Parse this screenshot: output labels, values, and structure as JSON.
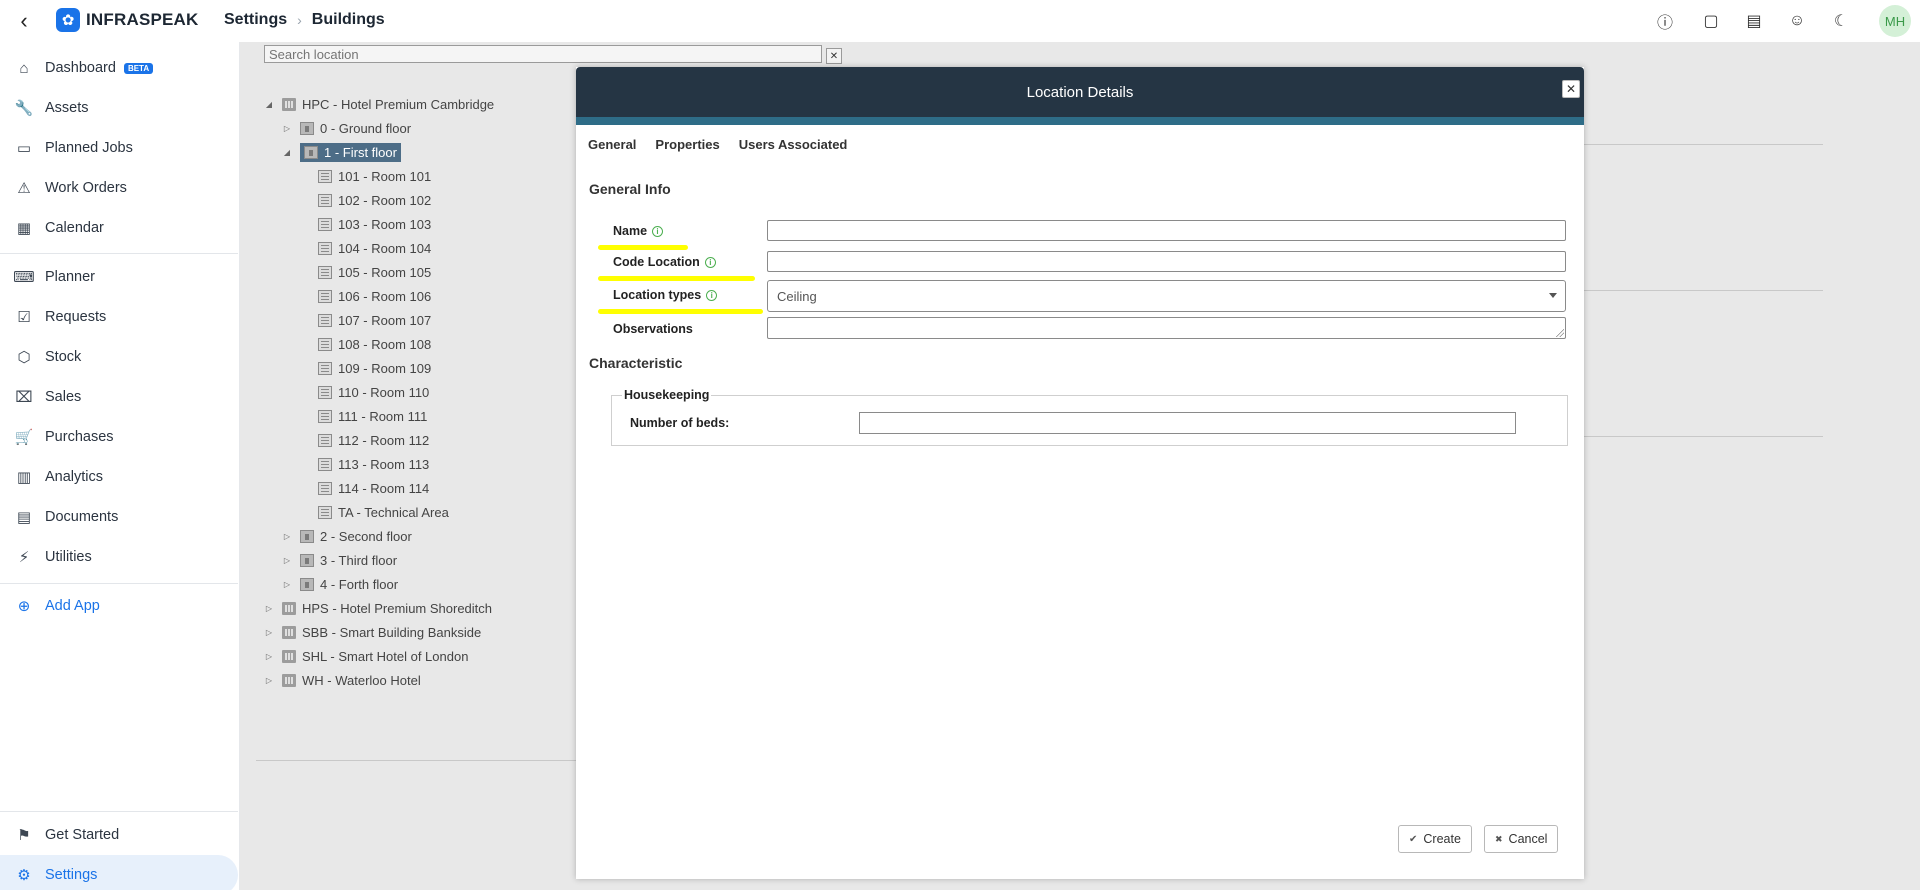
{
  "app": {
    "name": "INFRASPEAK"
  },
  "breadcrumb": [
    "Settings",
    "Buildings"
  ],
  "top_icons": [
    {
      "name": "info-icon",
      "glyph": "ⓘ",
      "badge": ""
    },
    {
      "name": "chat-help-icon",
      "glyph": "▢",
      "badge": "?"
    },
    {
      "name": "calendar-help-icon",
      "glyph": "▤",
      "badge": "?"
    },
    {
      "name": "smiley-icon",
      "glyph": "☺",
      "badge": ""
    },
    {
      "name": "moon-icon",
      "glyph": "☾",
      "badge": ""
    }
  ],
  "user": {
    "initials": "MH"
  },
  "sidebar": {
    "items": [
      {
        "label": "Dashboard",
        "icon": "⌂",
        "badge": "BETA"
      },
      {
        "label": "Assets",
        "icon": "🔧"
      },
      {
        "label": "Planned Jobs",
        "icon": "▭"
      },
      {
        "label": "Work Orders",
        "icon": "⚠"
      },
      {
        "label": "Calendar",
        "icon": "▦"
      },
      {
        "label": "Planner",
        "icon": "⌨"
      },
      {
        "label": "Requests",
        "icon": "☑"
      },
      {
        "label": "Stock",
        "icon": "⬡"
      },
      {
        "label": "Sales",
        "icon": "⌧"
      },
      {
        "label": "Purchases",
        "icon": "🛒"
      },
      {
        "label": "Analytics",
        "icon": "▥"
      },
      {
        "label": "Documents",
        "icon": "▤"
      },
      {
        "label": "Utilities",
        "icon": "⚡"
      }
    ],
    "add_app": "Add App",
    "get_started": "Get Started",
    "settings": "Settings"
  },
  "search": {
    "placeholder": "Search location",
    "clear": "✕"
  },
  "tree": [
    {
      "label": "HPC - Hotel Premium Cambridge",
      "level": 0,
      "toggle": "◢",
      "kind": "building"
    },
    {
      "label": "0 - Ground floor",
      "level": 1,
      "toggle": "▷",
      "kind": "floor"
    },
    {
      "label": "1 - First floor",
      "level": 1,
      "toggle": "◢",
      "kind": "floor",
      "selected": true
    },
    {
      "label": "101 - Room 101",
      "level": 2,
      "toggle": "",
      "kind": "room"
    },
    {
      "label": "102 - Room 102",
      "level": 2,
      "toggle": "",
      "kind": "room"
    },
    {
      "label": "103 - Room 103",
      "level": 2,
      "toggle": "",
      "kind": "room"
    },
    {
      "label": "104 - Room 104",
      "level": 2,
      "toggle": "",
      "kind": "room"
    },
    {
      "label": "105 - Room 105",
      "level": 2,
      "toggle": "",
      "kind": "room"
    },
    {
      "label": "106 - Room 106",
      "level": 2,
      "toggle": "",
      "kind": "room"
    },
    {
      "label": "107 - Room 107",
      "level": 2,
      "toggle": "",
      "kind": "room"
    },
    {
      "label": "108 - Room 108",
      "level": 2,
      "toggle": "",
      "kind": "room"
    },
    {
      "label": "109 - Room 109",
      "level": 2,
      "toggle": "",
      "kind": "room"
    },
    {
      "label": "110 - Room 110",
      "level": 2,
      "toggle": "",
      "kind": "room"
    },
    {
      "label": "111 - Room 111",
      "level": 2,
      "toggle": "",
      "kind": "room"
    },
    {
      "label": "112 - Room 112",
      "level": 2,
      "toggle": "",
      "kind": "room"
    },
    {
      "label": "113 - Room 113",
      "level": 2,
      "toggle": "",
      "kind": "room"
    },
    {
      "label": "114 - Room 114",
      "level": 2,
      "toggle": "",
      "kind": "room"
    },
    {
      "label": "TA - Technical Area",
      "level": 2,
      "toggle": "",
      "kind": "room"
    },
    {
      "label": "2 - Second floor",
      "level": 1,
      "toggle": "▷",
      "kind": "floor"
    },
    {
      "label": "3 - Third floor",
      "level": 1,
      "toggle": "▷",
      "kind": "floor"
    },
    {
      "label": "4 - Forth floor",
      "level": 1,
      "toggle": "▷",
      "kind": "floor"
    },
    {
      "label": "HPS - Hotel Premium Shoreditch",
      "level": 0,
      "toggle": "▷",
      "kind": "building"
    },
    {
      "label": "SBB - Smart Building Bankside",
      "level": 0,
      "toggle": "▷",
      "kind": "building"
    },
    {
      "label": "SHL - Smart Hotel of London",
      "level": 0,
      "toggle": "▷",
      "kind": "building"
    },
    {
      "label": "WH - Waterloo Hotel",
      "level": 0,
      "toggle": "▷",
      "kind": "building"
    }
  ],
  "modal": {
    "title": "Location Details",
    "close": "✕",
    "tabs": [
      "General",
      "Properties",
      "Users Associated"
    ],
    "general_info": "General Info",
    "fields": {
      "name": {
        "label": "Name",
        "value": ""
      },
      "code": {
        "label": "Code Location",
        "value": ""
      },
      "types": {
        "label": "Location types",
        "value": "Ceiling"
      },
      "observations": {
        "label": "Observations",
        "value": ""
      }
    },
    "characteristic": "Characteristic",
    "housekeeping": {
      "legend": "Housekeeping",
      "beds_label": "Number of beds:",
      "beds_value": ""
    },
    "buttons": {
      "create": "Create",
      "create_icon": "✔",
      "cancel": "Cancel",
      "cancel_icon": "✖"
    }
  },
  "colors": {
    "accent": "#1a73e8",
    "modal_header": "#253544",
    "modal_stripe": "#2e6c87",
    "selected_node": "#4d6d87",
    "highlight": "#ffff00"
  }
}
